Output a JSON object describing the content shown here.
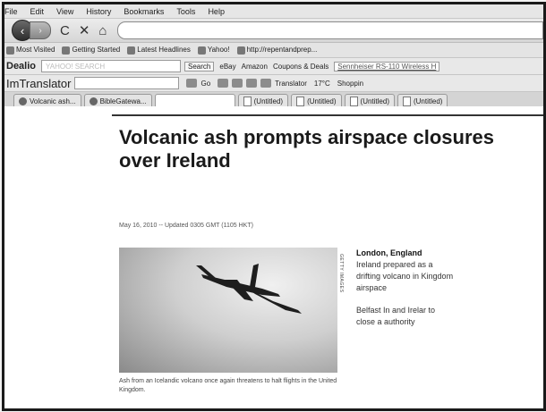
{
  "menu": [
    "File",
    "Edit",
    "View",
    "History",
    "Bookmarks",
    "Tools",
    "Help"
  ],
  "nav": {
    "back": "‹",
    "forward": "›",
    "reload": "C",
    "stop": "✕",
    "home": "⌂"
  },
  "bookmarks": [
    "Most Visited",
    "Getting Started",
    "Latest Headlines",
    "Yahoo!",
    "http://repentandprep..."
  ],
  "dealio": {
    "brand": "Dealio",
    "search_placeholder": "YAHOO! SEARCH",
    "search_button": "Search",
    "ebay": "eBay",
    "amazon": "Amazon",
    "coupons": "Coupons & Deals",
    "product": "Sennheiser RS-110 Wireless H"
  },
  "imtranslator": {
    "brand": "ImTranslator",
    "go": "Go",
    "translator": "Translator",
    "temp": "17°C",
    "shopping": "Shoppin"
  },
  "tabs": [
    "Volcanic ash...",
    "BibleGatewa...",
    "",
    "(Untitled)",
    "(Untitled)",
    "(Untitled)",
    "(Untitled)"
  ],
  "article": {
    "headline": "Volcanic ash prompts airspace closures over Ireland",
    "dateline": "May 16, 2010 -- Updated 0305 GMT (1105 HKT)",
    "photo_credit": "GETTY IMAGES",
    "caption": "Ash from an Icelandic volcano once again threatens to halt flights in the United Kingdom.",
    "location": "London, England",
    "para1": "Ireland prepared as a drifting volcano in Kingdom airspace",
    "para2": "Belfast In and Irelar to close a authority"
  }
}
